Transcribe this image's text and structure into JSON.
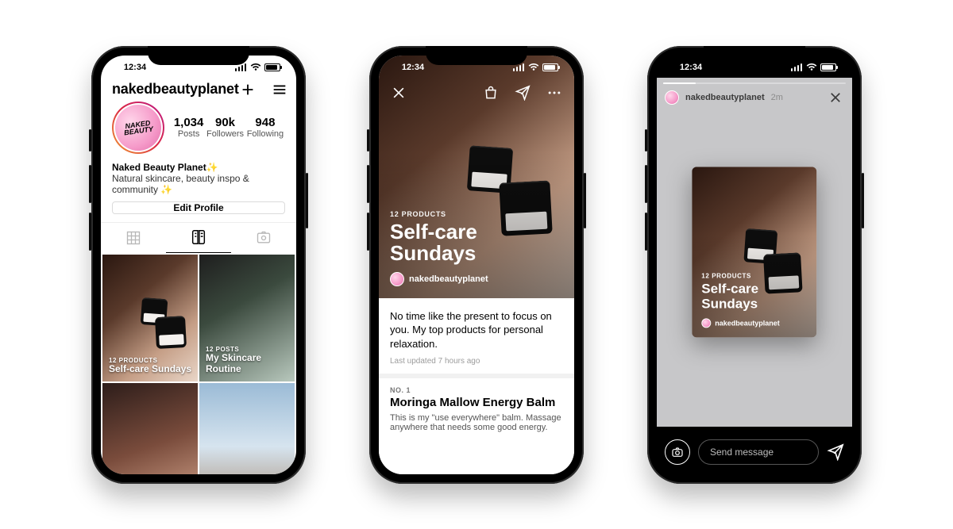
{
  "status": {
    "time": "12:34"
  },
  "phone1": {
    "username": "nakedbeautyplanet",
    "avatar_text": "NAKED BEAUTY",
    "stats": {
      "posts": {
        "value": "1,034",
        "label": "Posts"
      },
      "followers": {
        "value": "90k",
        "label": "Followers"
      },
      "following": {
        "value": "948",
        "label": "Following"
      }
    },
    "bio": {
      "display_name": "Naked Beauty Planet",
      "emoji_name": "✨",
      "description": "Natural skincare, beauty inspo & community ✨"
    },
    "edit_button": "Edit Profile",
    "guides": [
      {
        "count_label": "12 PRODUCTS",
        "title": "Self-care Sundays"
      },
      {
        "count_label": "12 POSTS",
        "title": "My Skincare Routine"
      }
    ]
  },
  "phone2": {
    "header": {
      "count_label": "12 PRODUCTS",
      "title": "Self-care Sundays",
      "author": "nakedbeautyplanet"
    },
    "blurb": "No time like the present to focus on you. My top products for personal relaxation.",
    "updated": "Last updated 7 hours ago",
    "item": {
      "no": "NO. 1",
      "name": "Moringa Mallow Energy Balm",
      "desc": "This is my \"use everywhere\" balm. Massage anywhere that needs some good energy."
    }
  },
  "phone3": {
    "author": "nakedbeautyplanet",
    "age": "2m",
    "card": {
      "count_label": "12 PRODUCTS",
      "title": "Self-care Sundays"
    },
    "reply_placeholder": "Send message"
  }
}
